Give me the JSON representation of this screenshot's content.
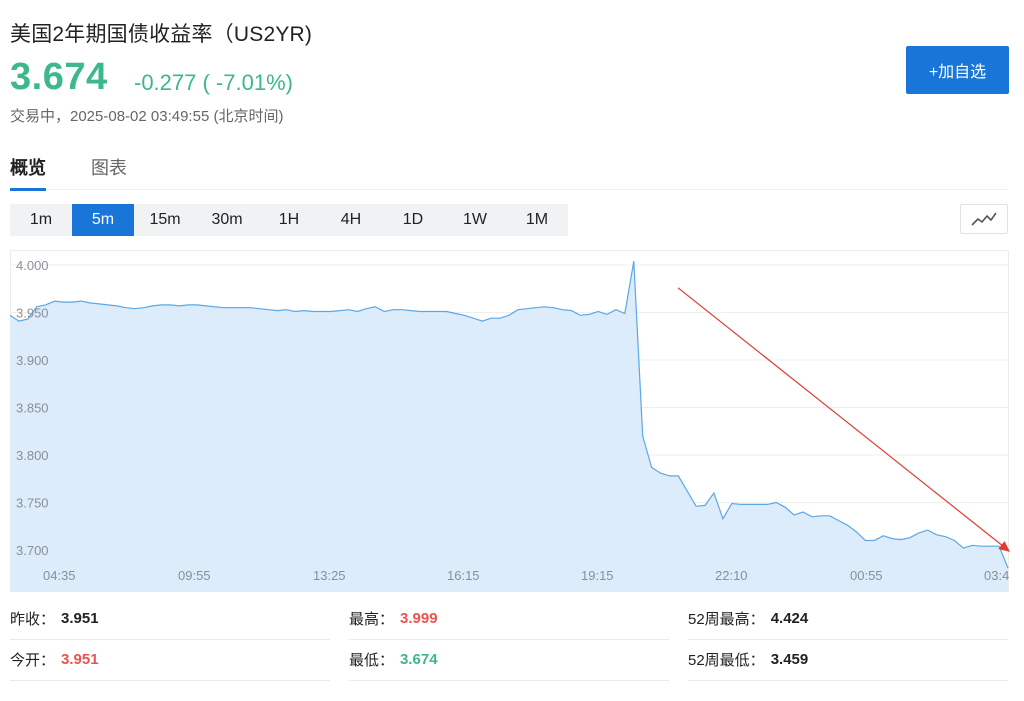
{
  "header": {
    "title": "美国2年期国债收益率（US2YR)",
    "price": "3.674",
    "change": "-0.277 ( -7.01%)",
    "status": "交易中，2025-08-02 03:49:55 (北京时间)",
    "add_button": "+加自选"
  },
  "tabs": [
    {
      "label": "概览",
      "active": true
    },
    {
      "label": "图表",
      "active": false
    }
  ],
  "periods": [
    {
      "label": "1m",
      "active": false
    },
    {
      "label": "5m",
      "active": true
    },
    {
      "label": "15m",
      "active": false
    },
    {
      "label": "30m",
      "active": false
    },
    {
      "label": "1H",
      "active": false
    },
    {
      "label": "4H",
      "active": false
    },
    {
      "label": "1D",
      "active": false
    },
    {
      "label": "1W",
      "active": false
    },
    {
      "label": "1M",
      "active": false
    }
  ],
  "chart_type_icon": "line-chart-icon",
  "colors": {
    "up": "#e8554f",
    "down": "#3cb88a",
    "accent": "#1976d8",
    "line": "#5aa8e6",
    "fill": "#dcecfb",
    "arrow": "#e03c31"
  },
  "chart_data": {
    "type": "area",
    "ylim": [
      3.68,
      4.01
    ],
    "y_ticks": [
      "4.000",
      "3.950",
      "3.900",
      "3.850",
      "3.800",
      "3.750",
      "3.700"
    ],
    "y_tick_values": [
      4.0,
      3.95,
      3.9,
      3.85,
      3.8,
      3.75,
      3.7
    ],
    "x_tick_labels": [
      "04:35",
      "09:55",
      "13:25",
      "16:15",
      "19:15",
      "22:10",
      "00:55",
      "03:4"
    ],
    "series": [
      {
        "values": [
          3.947,
          3.941,
          3.943,
          3.956,
          3.958,
          3.962,
          3.961,
          3.961,
          3.962,
          3.96,
          3.959,
          3.958,
          3.957,
          3.955,
          3.954,
          3.955,
          3.957,
          3.958,
          3.958,
          3.957,
          3.958,
          3.958,
          3.957,
          3.956,
          3.955,
          3.955,
          3.955,
          3.955,
          3.954,
          3.953,
          3.952,
          3.953,
          3.951,
          3.952,
          3.951,
          3.951,
          3.951,
          3.952,
          3.953,
          3.951,
          3.954,
          3.956,
          3.951,
          3.953,
          3.953,
          3.952,
          3.951,
          3.951,
          3.951,
          3.951,
          3.949,
          3.947,
          3.944,
          3.941,
          3.944,
          3.944,
          3.947,
          3.953,
          3.954,
          3.955,
          3.956,
          3.955,
          3.953,
          3.952,
          3.947,
          3.948,
          3.951,
          3.948,
          3.953,
          3.949,
          4.004,
          3.82,
          3.787,
          3.781,
          3.778,
          3.778,
          3.762,
          3.746,
          3.747,
          3.76,
          3.733,
          3.749,
          3.748,
          3.748,
          3.748,
          3.748,
          3.75,
          3.745,
          3.737,
          3.74,
          3.735,
          3.736,
          3.736,
          3.731,
          3.726,
          3.719,
          3.71,
          3.71,
          3.715,
          3.712,
          3.711,
          3.713,
          3.718,
          3.721,
          3.716,
          3.714,
          3.71,
          3.702,
          3.705,
          3.704,
          3.704,
          3.704,
          3.681
        ]
      }
    ],
    "annotations": [
      {
        "type": "arrow",
        "description": "downtrend",
        "from": {
          "index": 75,
          "value": 3.976
        },
        "to": {
          "index": 114,
          "value": 3.698
        }
      }
    ]
  },
  "stats": [
    {
      "label": "昨收：",
      "value": "3.951",
      "tone": "neutral"
    },
    {
      "label": "最高：",
      "value": "3.999",
      "tone": "up"
    },
    {
      "label": "52周最高：",
      "value": "4.424",
      "tone": "neutral"
    },
    {
      "label": "今开：",
      "value": "3.951",
      "tone": "up"
    },
    {
      "label": "最低：",
      "value": "3.674",
      "tone": "down"
    },
    {
      "label": "52周最低：",
      "value": "3.459",
      "tone": "neutral"
    }
  ]
}
